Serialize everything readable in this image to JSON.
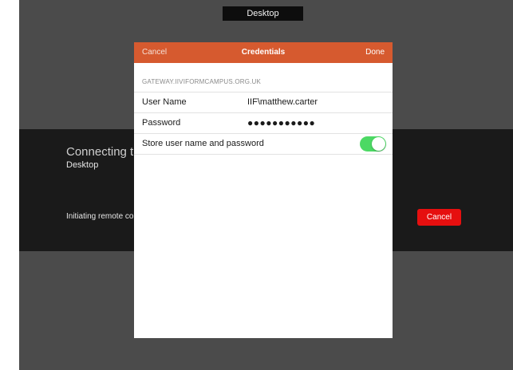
{
  "topbar": {
    "tab_label": "Desktop"
  },
  "connecting": {
    "title": "Connecting t",
    "subtitle": "Desktop",
    "status": "Initiating remote co",
    "cancel_label": "Cancel",
    "accent": "#e60f0f"
  },
  "dialog": {
    "header": {
      "cancel_label": "Cancel",
      "title": "Credentials",
      "done_label": "Done",
      "color": "#d65a2f"
    },
    "gateway_label": "GATEWAY.IIVIFORMCAMPUS.ORG.UK",
    "fields": {
      "username": {
        "label": "User Name",
        "value": "IIF\\matthew.carter"
      },
      "password": {
        "label": "Password",
        "value": "●●●●●●●●●●●"
      }
    },
    "store": {
      "label": "Store user name and password",
      "enabled": true,
      "toggle_color": "#4cd964"
    }
  }
}
